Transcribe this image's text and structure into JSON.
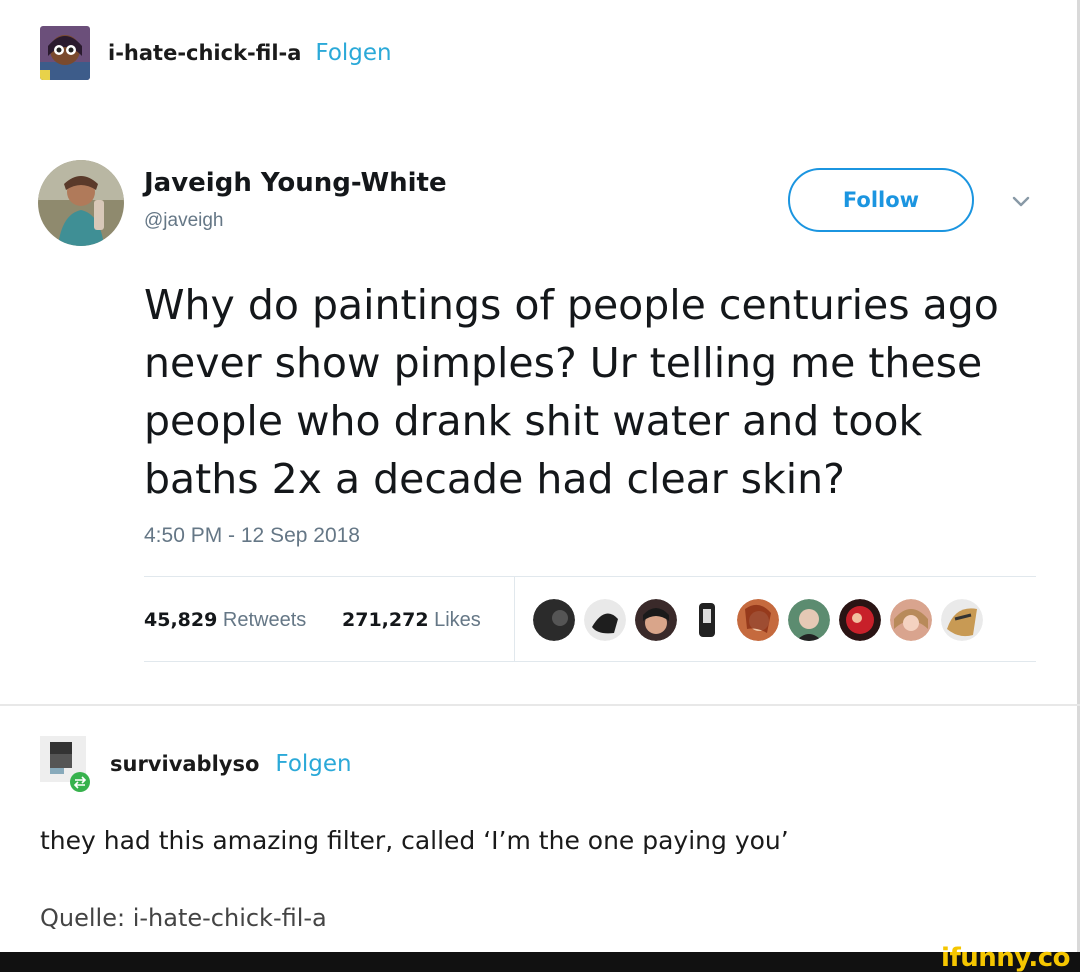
{
  "post": {
    "username": "i-hate-chick-fil-a",
    "follow_label": "Folgen"
  },
  "tweet": {
    "display_name": "Javeigh Young-White",
    "handle": "@javeigh",
    "follow_button": "Follow",
    "text": "Why do paintings of people centuries ago never show pimples? Ur telling me these people who drank shit water and took baths 2x a decade had clear skin?",
    "timestamp": "4:50 PM - 12 Sep 2018",
    "retweets_count": "45,829",
    "retweets_label": "Retweets",
    "likes_count": "271,272",
    "likes_label": "Likes",
    "accent_color": "#1b95e0"
  },
  "reblog": {
    "username": "survivablyso",
    "follow_label": "Folgen",
    "comment": "they had this amazing filter, called ‘I’m the one paying you’"
  },
  "source": {
    "label": "Quelle:",
    "name": "i-hate-chick-fil-a"
  },
  "watermark": "ifunny.co"
}
